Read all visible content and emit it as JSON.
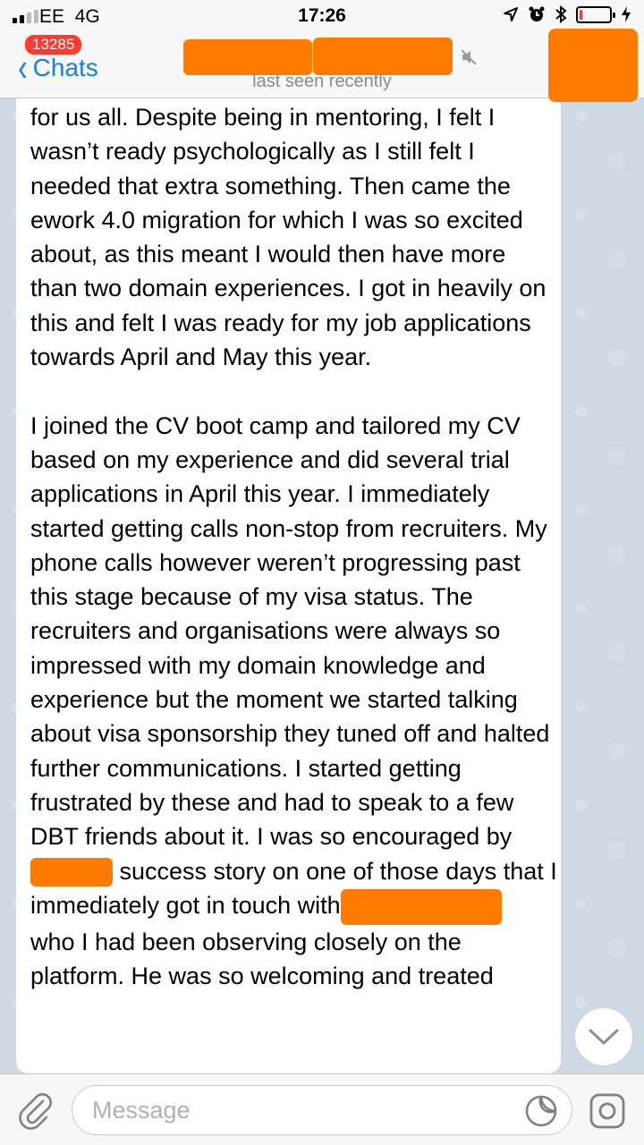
{
  "status_bar": {
    "carrier": "EE",
    "network": "4G",
    "time": "17:26",
    "icons": [
      "location-arrow-icon",
      "alarm-clock-icon",
      "bluetooth-icon",
      "battery-icon",
      "charging-bolt-icon"
    ],
    "battery_level": 0.1
  },
  "nav": {
    "back_label": "Chats",
    "unread_badge": "13285",
    "subtitle": "last seen recently",
    "muted_icon": "mute-icon"
  },
  "message": {
    "before_redact_1": "for us all. Despite being in mentoring, I felt I wasn’t ready psychologically as I still felt I needed that extra something. Then came the ework 4.0 migration for which I was so excited about, as this meant I would then have more than two domain experiences. I got in heavily on this and felt I was ready for my job applications towards April and May this year.\n\nI joined the CV boot camp and tailored my CV based on my experience and did several trial applications in April this year. I immediately started getting calls non-stop from recruiters. My phone calls however weren’t progressing past this stage because of my visa status. The recruiters and organisations were always so impressed with my domain knowledge and experience but the moment we started talking about visa sponsorship they tuned off and halted further communications. I started getting frustrated by these and had to speak to a few DBT friends about it. I was so encouraged by ",
    "between_redacts": " success story on one of those days that I immediately got in touch with",
    "after_redact_2": "\nwho I had been observing closely on the platform. He was so welcoming and treated"
  },
  "input": {
    "placeholder": "Message"
  },
  "colors": {
    "accent": "#1480e8",
    "badge": "#ff3b30",
    "redaction": "#ff7b00",
    "wallpaper": "#cfd9e3"
  }
}
